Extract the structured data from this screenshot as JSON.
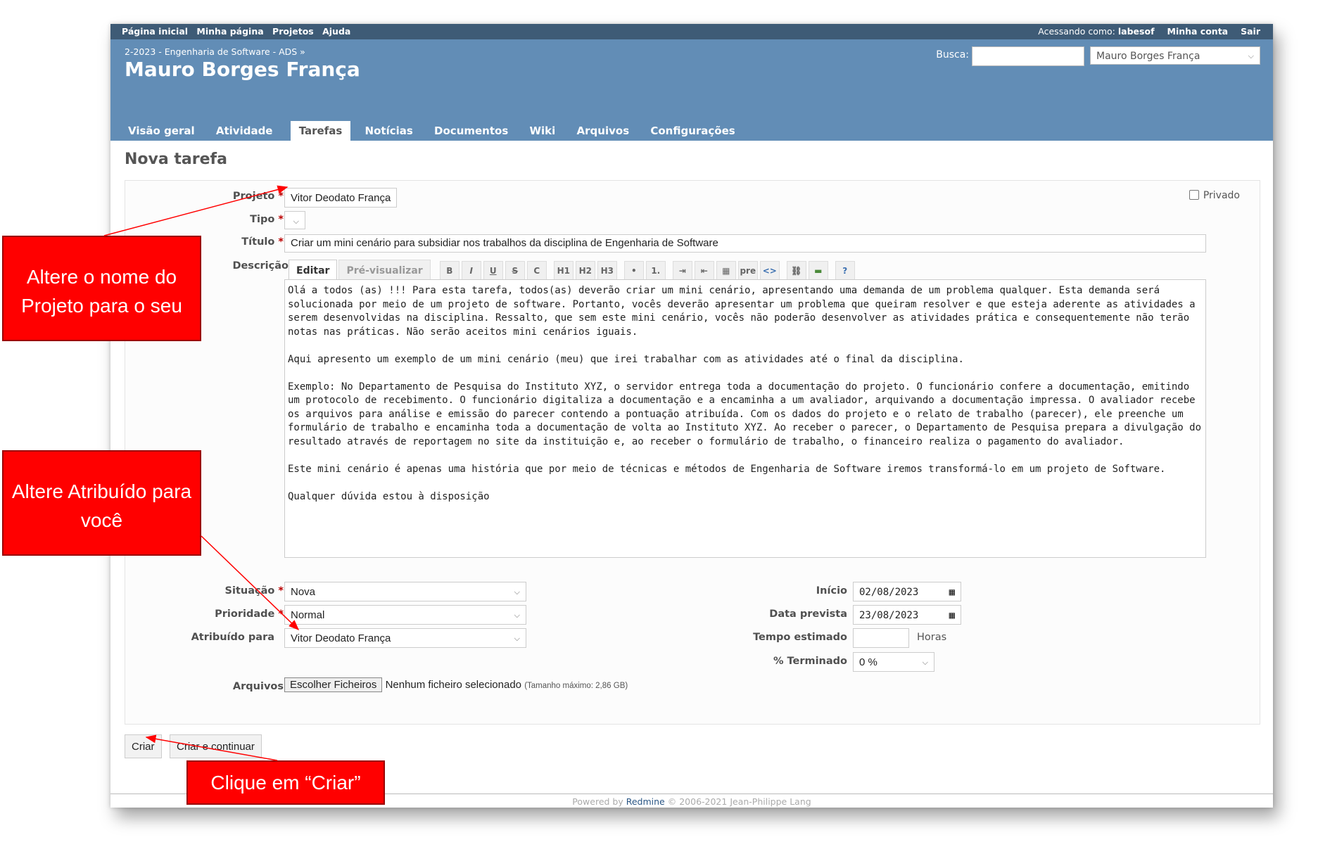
{
  "top_menu": {
    "items": [
      "Página inicial",
      "Minha página",
      "Projetos",
      "Ajuda"
    ],
    "logged_as_label": "Acessando como:",
    "user": "labesof",
    "account": "Minha conta",
    "logout": "Sair"
  },
  "header": {
    "breadcrumb": "2-2023 - Engenharia de Software - ADS »",
    "title": "Mauro Borges França",
    "search_label": "Busca:",
    "search_value": "",
    "project_jump": "Mauro Borges França"
  },
  "tabs": [
    "Visão geral",
    "Atividade",
    "Tarefas",
    "Notícias",
    "Documentos",
    "Wiki",
    "Arquivos",
    "Configurações"
  ],
  "selected_tab": "Tarefas",
  "page_title": "Nova tarefa",
  "form": {
    "project_label": "Projeto",
    "project_value": "Vitor Deodato França",
    "private_label": "Privado",
    "tracker_label": "Tipo",
    "subject_label": "Título",
    "subject_value": "Criar um mini cenário para subsidiar nos trabalhos da disciplina de Engenharia de Software",
    "description_label": "Descrição",
    "edit_tab": "Editar",
    "preview_tab": "Pré-visualizar",
    "toolbar": [
      "B",
      "I",
      "U",
      "S",
      "C",
      "H1",
      "H2",
      "H3",
      "•",
      "1.",
      "⇥",
      "⇤",
      "▦",
      "pre",
      "<>",
      "⛓",
      "▬",
      "?"
    ],
    "description_paragraphs": [
      "Olá a todos (as) !!! Para esta tarefa, todos(as) deverão criar um mini cenário, apresentando uma demanda de um problema qualquer. Esta demanda será solucionada por meio de um projeto de software. Portanto, vocês deverão apresentar um problema que queiram resolver e que esteja aderente as atividades a serem desenvolvidas na disciplina. Ressalto, que sem este mini cenário, vocês não poderão desenvolver as atividades prática e consequentemente não terão notas nas práticas. Não serão aceitos mini cenários iguais.",
      "Aqui apresento um exemplo de um mini cenário (meu) que irei trabalhar com as atividades até o final da disciplina.",
      "Exemplo: No Departamento de Pesquisa do Instituto XYZ, o servidor entrega toda a documentação do projeto. O funcionário confere a documentação, emitindo um protocolo de recebimento. O funcionário digitaliza a documentação e a encaminha a um avaliador, arquivando a documentação impressa. O avaliador recebe os arquivos para análise e emissão do parecer contendo a pontuação atribuída. Com os dados do projeto e o relato de trabalho (parecer), ele preenche um formulário de trabalho e encaminha toda a documentação de volta ao Instituto XYZ. Ao receber o parecer, o Departamento de Pesquisa prepara a divulgação do resultado através de reportagem no site da instituição e, ao receber o formulário de trabalho, o financeiro realiza o pagamento do avaliador.",
      "Este mini cenário é apenas uma história que por meio de técnicas e métodos de Engenharia de Software iremos transformá-lo em um projeto de Software.",
      "Qualquer dúvida estou à disposição"
    ],
    "status_label": "Situação",
    "status_value": "Nova",
    "priority_label": "Prioridade",
    "priority_value": "Normal",
    "assignee_label": "Atribuído para",
    "assignee_value": "Vitor Deodato França",
    "start_label": "Início",
    "start_value": "02/08/2023",
    "due_label": "Data prevista",
    "due_value": "23/08/2023",
    "estimated_label": "Tempo estimado",
    "estimated_value": "",
    "hours_label": "Horas",
    "done_label": "% Terminado",
    "done_value": "0 %",
    "files_label": "Arquivos",
    "choose_files": "Escolher Ficheiros",
    "no_file": "Nenhum ficheiro selecionado",
    "max_size": "(Tamanho máximo: 2,86 GB)"
  },
  "buttons": {
    "create": "Criar",
    "create_continue": "Criar e continuar"
  },
  "footer": {
    "powered": "Powered by",
    "link": "Redmine",
    "copyright": "© 2006-2021 Jean-Philippe Lang"
  },
  "annotations": {
    "note_project": "Altere o nome do Projeto para o seu",
    "note_assignee": "Altere Atribuído para você",
    "note_create": "Clique em “Criar”"
  },
  "colors": {
    "header": "#628db6",
    "top_menu": "#3e5b76",
    "annotation": "#ff0000",
    "required": "#bb0000"
  }
}
